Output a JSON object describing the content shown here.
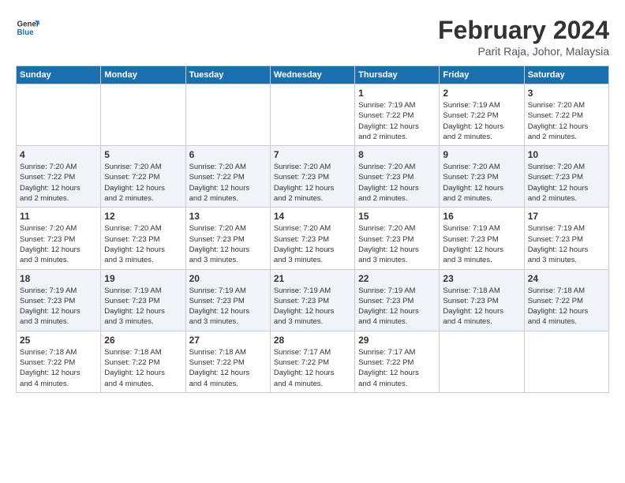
{
  "header": {
    "logo_general": "General",
    "logo_blue": "Blue",
    "month_title": "February 2024",
    "location": "Parit Raja, Johor, Malaysia"
  },
  "days_of_week": [
    "Sunday",
    "Monday",
    "Tuesday",
    "Wednesday",
    "Thursday",
    "Friday",
    "Saturday"
  ],
  "weeks": [
    [
      {
        "day": "",
        "info": ""
      },
      {
        "day": "",
        "info": ""
      },
      {
        "day": "",
        "info": ""
      },
      {
        "day": "",
        "info": ""
      },
      {
        "day": "1",
        "info": "Sunrise: 7:19 AM\nSunset: 7:22 PM\nDaylight: 12 hours\nand 2 minutes."
      },
      {
        "day": "2",
        "info": "Sunrise: 7:19 AM\nSunset: 7:22 PM\nDaylight: 12 hours\nand 2 minutes."
      },
      {
        "day": "3",
        "info": "Sunrise: 7:20 AM\nSunset: 7:22 PM\nDaylight: 12 hours\nand 2 minutes."
      }
    ],
    [
      {
        "day": "4",
        "info": "Sunrise: 7:20 AM\nSunset: 7:22 PM\nDaylight: 12 hours\nand 2 minutes."
      },
      {
        "day": "5",
        "info": "Sunrise: 7:20 AM\nSunset: 7:22 PM\nDaylight: 12 hours\nand 2 minutes."
      },
      {
        "day": "6",
        "info": "Sunrise: 7:20 AM\nSunset: 7:22 PM\nDaylight: 12 hours\nand 2 minutes."
      },
      {
        "day": "7",
        "info": "Sunrise: 7:20 AM\nSunset: 7:23 PM\nDaylight: 12 hours\nand 2 minutes."
      },
      {
        "day": "8",
        "info": "Sunrise: 7:20 AM\nSunset: 7:23 PM\nDaylight: 12 hours\nand 2 minutes."
      },
      {
        "day": "9",
        "info": "Sunrise: 7:20 AM\nSunset: 7:23 PM\nDaylight: 12 hours\nand 2 minutes."
      },
      {
        "day": "10",
        "info": "Sunrise: 7:20 AM\nSunset: 7:23 PM\nDaylight: 12 hours\nand 2 minutes."
      }
    ],
    [
      {
        "day": "11",
        "info": "Sunrise: 7:20 AM\nSunset: 7:23 PM\nDaylight: 12 hours\nand 3 minutes."
      },
      {
        "day": "12",
        "info": "Sunrise: 7:20 AM\nSunset: 7:23 PM\nDaylight: 12 hours\nand 3 minutes."
      },
      {
        "day": "13",
        "info": "Sunrise: 7:20 AM\nSunset: 7:23 PM\nDaylight: 12 hours\nand 3 minutes."
      },
      {
        "day": "14",
        "info": "Sunrise: 7:20 AM\nSunset: 7:23 PM\nDaylight: 12 hours\nand 3 minutes."
      },
      {
        "day": "15",
        "info": "Sunrise: 7:20 AM\nSunset: 7:23 PM\nDaylight: 12 hours\nand 3 minutes."
      },
      {
        "day": "16",
        "info": "Sunrise: 7:19 AM\nSunset: 7:23 PM\nDaylight: 12 hours\nand 3 minutes."
      },
      {
        "day": "17",
        "info": "Sunrise: 7:19 AM\nSunset: 7:23 PM\nDaylight: 12 hours\nand 3 minutes."
      }
    ],
    [
      {
        "day": "18",
        "info": "Sunrise: 7:19 AM\nSunset: 7:23 PM\nDaylight: 12 hours\nand 3 minutes."
      },
      {
        "day": "19",
        "info": "Sunrise: 7:19 AM\nSunset: 7:23 PM\nDaylight: 12 hours\nand 3 minutes."
      },
      {
        "day": "20",
        "info": "Sunrise: 7:19 AM\nSunset: 7:23 PM\nDaylight: 12 hours\nand 3 minutes."
      },
      {
        "day": "21",
        "info": "Sunrise: 7:19 AM\nSunset: 7:23 PM\nDaylight: 12 hours\nand 3 minutes."
      },
      {
        "day": "22",
        "info": "Sunrise: 7:19 AM\nSunset: 7:23 PM\nDaylight: 12 hours\nand 4 minutes."
      },
      {
        "day": "23",
        "info": "Sunrise: 7:18 AM\nSunset: 7:23 PM\nDaylight: 12 hours\nand 4 minutes."
      },
      {
        "day": "24",
        "info": "Sunrise: 7:18 AM\nSunset: 7:22 PM\nDaylight: 12 hours\nand 4 minutes."
      }
    ],
    [
      {
        "day": "25",
        "info": "Sunrise: 7:18 AM\nSunset: 7:22 PM\nDaylight: 12 hours\nand 4 minutes."
      },
      {
        "day": "26",
        "info": "Sunrise: 7:18 AM\nSunset: 7:22 PM\nDaylight: 12 hours\nand 4 minutes."
      },
      {
        "day": "27",
        "info": "Sunrise: 7:18 AM\nSunset: 7:22 PM\nDaylight: 12 hours\nand 4 minutes."
      },
      {
        "day": "28",
        "info": "Sunrise: 7:17 AM\nSunset: 7:22 PM\nDaylight: 12 hours\nand 4 minutes."
      },
      {
        "day": "29",
        "info": "Sunrise: 7:17 AM\nSunset: 7:22 PM\nDaylight: 12 hours\nand 4 minutes."
      },
      {
        "day": "",
        "info": ""
      },
      {
        "day": "",
        "info": ""
      }
    ]
  ]
}
